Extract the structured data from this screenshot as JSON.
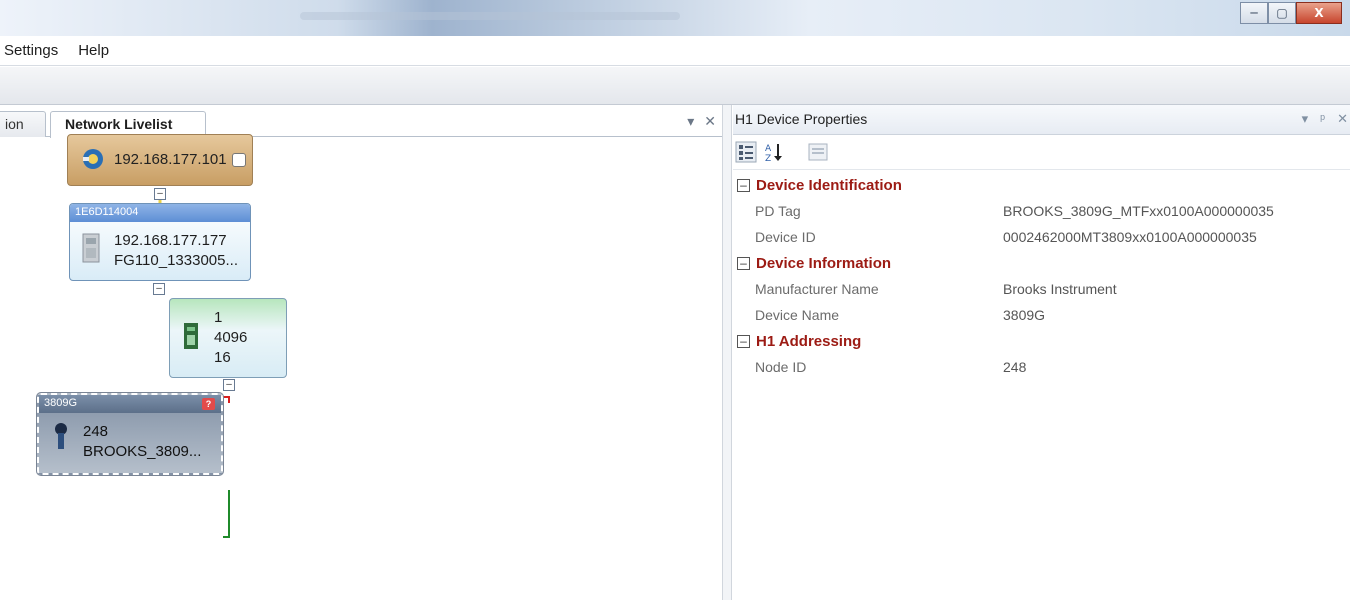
{
  "window": {
    "buttons": {
      "minimize": "─",
      "maximize": "▢",
      "close": "X"
    }
  },
  "menu": {
    "items": [
      "Settings",
      "Help"
    ]
  },
  "left_pane": {
    "tabs": [
      "ion",
      "Network Livelist"
    ],
    "controls": {
      "dropdown": "▾",
      "close": "✕"
    },
    "nodes": {
      "gateway": {
        "ip": "192.168.177.101"
      },
      "linking_device": {
        "header": "1E6D114004",
        "ip": "192.168.177.177",
        "name": "FG110_1333005..."
      },
      "segment": {
        "line1": "1",
        "line2": "4096",
        "line3": "16"
      },
      "device": {
        "header": "3809G",
        "badge": "?",
        "address": "248",
        "tag": "BROOKS_3809..."
      }
    },
    "wire_colors": {
      "ethernet": "#e8d24a",
      "hse": "#d92020",
      "h1": "#1f8a2a"
    }
  },
  "right_pane": {
    "title": "H1 Device Properties",
    "controls": {
      "dropdown": "▾",
      "pin": "ᵖ",
      "close": "✕"
    },
    "categories": [
      {
        "name": "Device Identification",
        "toggle": "⊟",
        "properties": [
          {
            "name": "PD Tag",
            "value": "BROOKS_3809G_MTFxx0100A000000035"
          },
          {
            "name": "Device ID",
            "value": "0002462000MT3809xx0100A000000035"
          }
        ]
      },
      {
        "name": "Device Information",
        "toggle": "⊟",
        "properties": [
          {
            "name": "Manufacturer Name",
            "value": "Brooks Instrument"
          },
          {
            "name": "Device Name",
            "value": "3809G"
          }
        ]
      },
      {
        "name": "H1 Addressing",
        "toggle": "⊟",
        "properties": [
          {
            "name": "Node ID",
            "value": "248"
          }
        ]
      }
    ]
  },
  "colors": {
    "category_text": "#9c1b14",
    "accent_blue": "#5d8ed5"
  }
}
